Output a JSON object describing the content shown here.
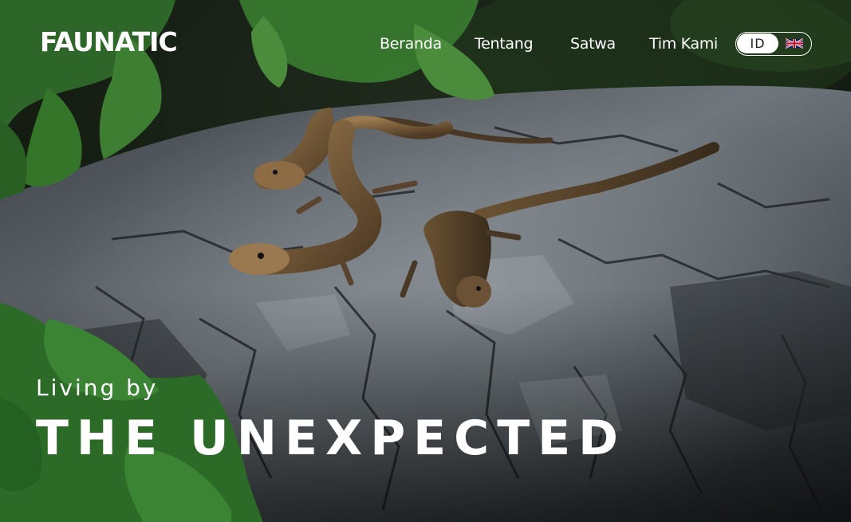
{
  "brand": {
    "logo_text": "FAUNATIC"
  },
  "nav": {
    "items": [
      {
        "label": "Beranda"
      },
      {
        "label": "Tentang"
      },
      {
        "label": "Satwa"
      },
      {
        "label": "Tim Kami"
      }
    ]
  },
  "language": {
    "active_label": "ID",
    "alt_flag_icon": "uk-flag-icon"
  },
  "hero": {
    "subtitle": "Living by",
    "title": "THE UNEXPECTED",
    "image_subject": "lizards-on-charred-log-photo"
  },
  "colors": {
    "text": "#ffffff",
    "toggle_active_bg": "#ffffff",
    "toggle_active_text": "#1d1d1d",
    "foliage": "#2f6a2a",
    "rock": "#4a4f54"
  }
}
